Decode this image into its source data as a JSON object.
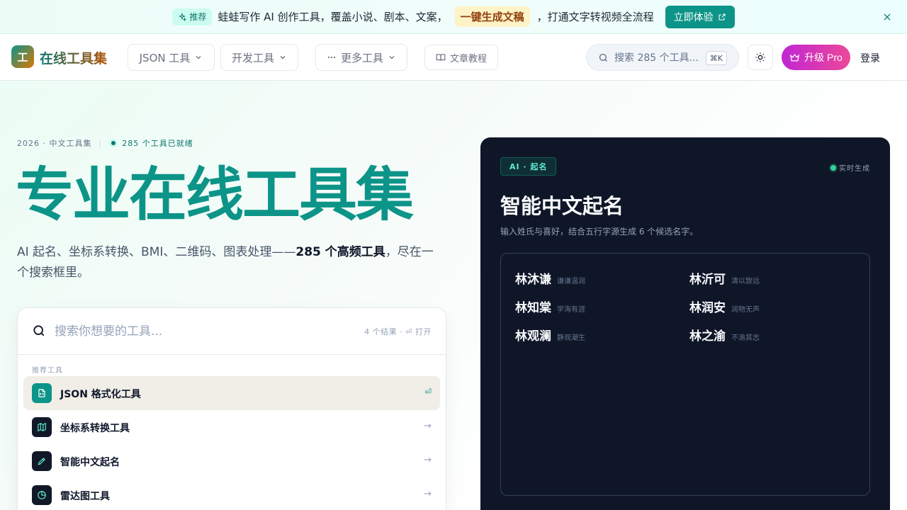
{
  "announcement": {
    "badge": "推荐",
    "message": "蛙蛙写作 AI 创作工具，覆盖小说、剧本、文案，",
    "highlight": "一键生成文稿",
    "message_tail": "，打通文字转视频全流程",
    "cta": "立即体验"
  },
  "header": {
    "logo_mark": "工",
    "logo_text": "在线工具集",
    "nav": {
      "json_tools": "JSON 工具",
      "dev_tools": "开发工具",
      "more_tools": "更多工具",
      "tutorials": "文章教程"
    },
    "search_placeholder": "搜索 285 个工具...",
    "search_shortcut": "⌘K",
    "pro_label": "升级 Pro",
    "login_label": "登录"
  },
  "hero": {
    "eyebrow_left": "2026 · 中文工具集",
    "eyebrow_sep": "|",
    "eyebrow_ready": "285 个工具已就绪",
    "title": "专业在线工具集",
    "subtitle_pre": "AI 起名、坐标系转换、BMI、二维码、图表处理——",
    "subtitle_bold": "285 个高频工具",
    "subtitle_post": "，尽在一个搜索框里。"
  },
  "search_card": {
    "placeholder": "搜索你想要的工具...",
    "meta": "4 个结果 · ⏎ 打开",
    "section_label": "推荐工具",
    "items": [
      {
        "label": "JSON 格式化工具",
        "end": "⏎"
      },
      {
        "label": "坐标系转换工具",
        "end": "→"
      },
      {
        "label": "智能中文起名",
        "end": "→"
      },
      {
        "label": "雷达图工具",
        "end": "→"
      }
    ]
  },
  "naming_card": {
    "tag": "AI · 起名",
    "live": "实时生成",
    "title": "智能中文起名",
    "description": "输入姓氏与喜好，结合五行字源生成 6 个候选名字。",
    "names": [
      {
        "name": "林沐谦",
        "meaning": "谦谦温润"
      },
      {
        "name": "林沂可",
        "meaning": "清以致远"
      },
      {
        "name": "林知棠",
        "meaning": "学海有涯"
      },
      {
        "name": "林润安",
        "meaning": "润物无声"
      },
      {
        "name": "林观澜",
        "meaning": "静观潮生"
      },
      {
        "name": "林之渝",
        "meaning": "不渝其志"
      }
    ]
  },
  "colors": {
    "brand": "#0d9488",
    "pro_gradient_start": "#c026d3",
    "pro_gradient_end": "#ec4899",
    "dark_card": "#0f1628"
  }
}
